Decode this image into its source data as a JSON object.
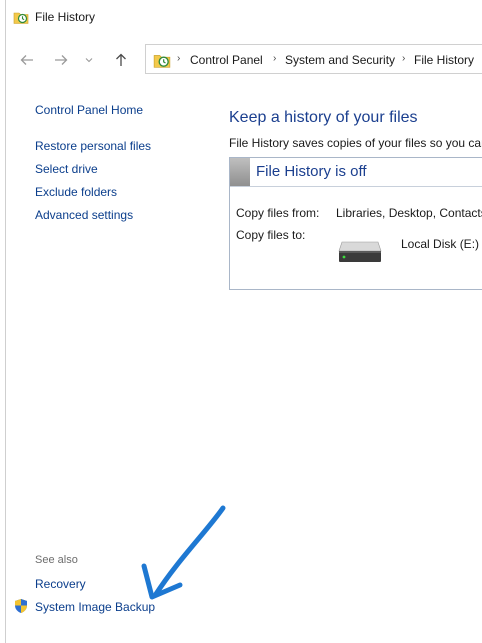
{
  "window": {
    "title": "File History"
  },
  "address": {
    "crumbs": [
      "Control Panel",
      "System and Security",
      "File History"
    ]
  },
  "left_pane": {
    "home": "Control Panel Home",
    "links": [
      "Restore personal files",
      "Select drive",
      "Exclude folders",
      "Advanced settings"
    ],
    "see_also_label": "See also",
    "see_also_links": [
      "Recovery",
      "System Image Backup"
    ]
  },
  "main": {
    "heading": "Keep a history of your files",
    "description": "File History saves copies of your files so you can",
    "status_title": "File History is off",
    "copy_from_label": "Copy files from:",
    "copy_from_value": "Libraries, Desktop, Contacts,",
    "copy_to_label": "Copy files to:",
    "disk_name": "Local Disk (E:)"
  },
  "colors": {
    "link": "#0b3e8c",
    "heading": "#1b3f8f",
    "annotation_arrow": "#1e78d2"
  },
  "icons": {
    "app": "file-history-icon",
    "back": "back-arrow-icon",
    "forward": "forward-arrow-icon",
    "recent": "chevron-down-icon",
    "up": "up-arrow-icon",
    "disk": "hard-disk-icon",
    "shield": "uac-shield-icon"
  }
}
